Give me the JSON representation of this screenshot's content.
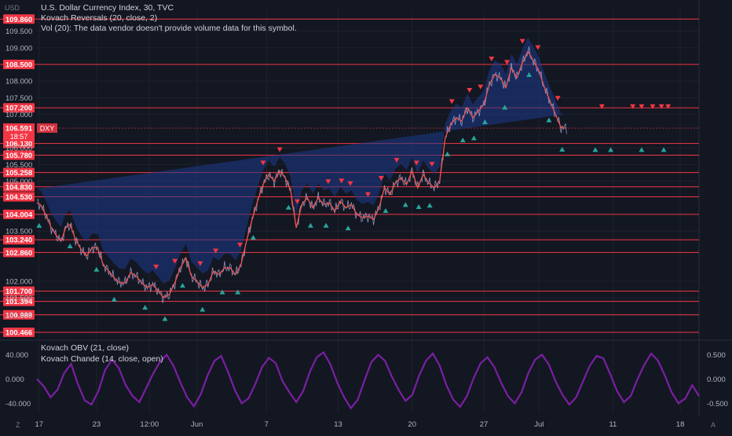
{
  "header": {
    "currency_label": "USD",
    "title": "U.S. Dollar Currency Index, 30, TVC",
    "indicator_1": "Kovach Reversals (20, close, 2)",
    "indicator_2": "Vol (20): The data vendor doesn't provide volume data for this symbol."
  },
  "oscillator": {
    "label_1": "Kovach OBV (21, close)",
    "label_2": "Kovach Chande (14, close, open)",
    "left_ticks": [
      "40.000",
      "0.000",
      "-40.000"
    ],
    "right_ticks": [
      "0.500",
      "0.000",
      "-0.500"
    ],
    "color": "#7b1fa2"
  },
  "footer": {
    "left_icon": "Z",
    "right_icon": "A"
  },
  "price_marker": {
    "value": "106.591",
    "countdown": "18:57",
    "symbol": "DXY",
    "color": "#f23645"
  },
  "chart_data": {
    "type": "line",
    "series": [
      {
        "name": "DXY",
        "x_index": [
          0,
          3,
          8,
          13,
          18,
          22,
          26,
          30,
          35,
          40,
          45,
          50,
          55,
          60,
          65,
          70,
          75,
          80,
          85,
          90,
          95,
          100,
          105,
          110,
          115,
          120,
          125,
          130,
          135,
          140,
          145,
          150,
          155,
          160,
          165,
          170,
          175,
          180,
          185,
          190,
          195,
          200,
          205,
          210,
          215,
          220,
          225,
          230,
          235,
          240,
          245,
          250,
          255,
          260,
          265,
          270,
          275,
          280,
          285,
          290,
          295,
          300,
          305,
          310,
          315,
          320,
          325,
          330,
          335,
          340,
          345,
          350,
          355,
          360,
          365,
          370,
          375,
          380,
          385,
          390,
          395,
          400,
          405,
          410,
          415,
          420,
          425,
          430,
          435,
          440,
          445,
          450,
          455,
          460,
          465,
          470,
          475,
          480,
          485,
          490,
          495,
          500
        ],
        "values": [
          104.35,
          104.3,
          104.0,
          103.6,
          103.35,
          103.2,
          103.6,
          103.7,
          103.25,
          102.95,
          102.75,
          103.0,
          103.0,
          102.5,
          102.3,
          102.1,
          101.95,
          101.95,
          102.25,
          102.15,
          101.95,
          101.8,
          101.9,
          101.7,
          101.5,
          101.6,
          101.95,
          102.4,
          102.7,
          102.15,
          102.0,
          101.8,
          101.9,
          102.3,
          102.2,
          102.4,
          102.4,
          102.2,
          102.5,
          103.2,
          103.85,
          104.4,
          104.9,
          105.2,
          105.0,
          105.3,
          105.1,
          104.7,
          103.6,
          104.3,
          104.5,
          104.2,
          104.5,
          104.3,
          104.35,
          104.1,
          104.4,
          104.2,
          104.3,
          104.0,
          103.9,
          103.95,
          103.85,
          104.2,
          104.8,
          104.6,
          104.95,
          105.1,
          104.9,
          105.3,
          104.8,
          105.2,
          104.95,
          104.8,
          105.0,
          106.3,
          106.7,
          106.9,
          106.8,
          107.2,
          106.9,
          107.1,
          107.3,
          107.9,
          108.2,
          108.1,
          107.8,
          108.4,
          108.1,
          108.55,
          108.9,
          108.6,
          108.3,
          107.8,
          107.4,
          107.0,
          106.6,
          106.59
        ],
        "color": "#ef5350"
      }
    ],
    "x_tick_labels": [
      "17",
      "23",
      "12:00",
      "Jun",
      "7",
      "13",
      "20",
      "27",
      "Jul",
      "11",
      "18"
    ],
    "x_tick_index": [
      2,
      54,
      102,
      145,
      208,
      273,
      340,
      405,
      455,
      522,
      583
    ],
    "x_range": [
      0,
      600
    ],
    "y_tick_labels": [
      "109.500",
      "109.000",
      "108.000",
      "107.500",
      "107.000",
      "106.000",
      "105.500",
      "105.000",
      "103.500",
      "102.000",
      "101.500",
      "101.000"
    ],
    "y_tick_values": [
      109.5,
      109.0,
      108.0,
      107.5,
      107.0,
      106.0,
      105.5,
      105.0,
      103.5,
      102.0,
      101.5,
      101.0
    ],
    "ylim": [
      100.3,
      110.15
    ],
    "horizontal_levels": [
      "109.860",
      "108.500",
      "107.200",
      "106.130",
      "105.780",
      "105.258",
      "104.830",
      "104.530",
      "104.004",
      "103.240",
      "102.860",
      "101.700",
      "101.394",
      "100.989",
      "100.466"
    ],
    "horizontal_level_values": [
      109.86,
      108.5,
      107.2,
      106.13,
      105.78,
      105.258,
      104.83,
      104.53,
      104.004,
      103.24,
      102.86,
      101.7,
      101.394,
      100.989,
      100.466
    ],
    "level_color": "#f23645",
    "down_arrow_index": [
      108,
      125,
      148,
      162,
      184,
      205,
      220,
      236,
      264,
      276,
      284,
      300,
      312,
      326,
      344,
      358,
      376,
      392,
      402,
      412,
      426,
      440,
      454,
      472,
      488,
      500,
      512,
      540,
      548,
      558,
      566,
      572
    ],
    "up_arrow_index": [
      2,
      30,
      54,
      70,
      98,
      116,
      132,
      150,
      168,
      182,
      196,
      228,
      248,
      262,
      282,
      316,
      334,
      346,
      356,
      372,
      386,
      396,
      406,
      424,
      446,
      464,
      476,
      496,
      506,
      520,
      548,
      568
    ],
    "oscillator_values": [
      0,
      -12,
      -30,
      -18,
      10,
      25,
      -8,
      -35,
      -42,
      -20,
      15,
      32,
      18,
      -10,
      -28,
      -38,
      -15,
      8,
      28,
      40,
      22,
      -5,
      -30,
      -45,
      -25,
      6,
      30,
      38,
      12,
      -18,
      -40,
      -32,
      -8,
      20,
      35,
      26,
      -4,
      -22,
      -38,
      -20,
      12,
      36,
      44,
      24,
      -6,
      -30,
      -48,
      -34,
      -2,
      28,
      40,
      30,
      4,
      -18,
      -36,
      -26,
      6,
      30,
      42,
      22,
      -10,
      -34,
      -46,
      -28,
      2,
      26,
      36,
      20,
      -6,
      -28,
      -40,
      -22,
      10,
      32,
      40,
      24,
      -4,
      -26,
      -42,
      -30,
      -4,
      22,
      38,
      34,
      8,
      -20,
      -38,
      -28,
      0,
      24,
      42,
      30,
      6,
      -22,
      -40,
      -32,
      -10,
      -28
    ]
  }
}
